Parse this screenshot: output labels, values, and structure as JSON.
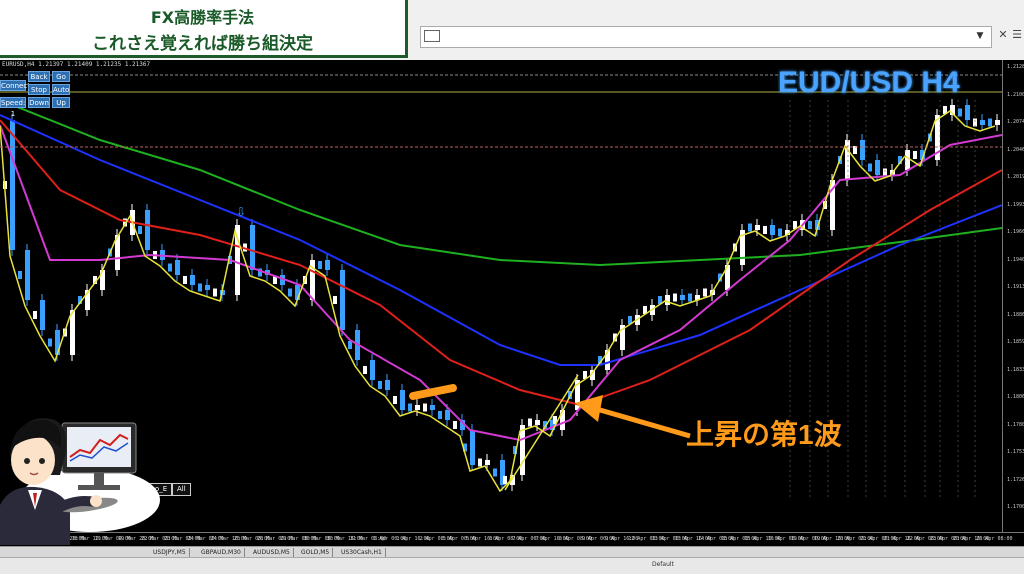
{
  "banner": {
    "line1": "FX高勝率手法",
    "line2": "これさえ覚えれば勝ち組決定"
  },
  "window": {
    "close": "✕",
    "min": "—",
    "drop": "▼"
  },
  "chart_info": "EURUSD,H4  1.21397 1.21409 1.21235 1.21367",
  "controls": {
    "back": "Back",
    "go": "Go",
    "connect": "Connect",
    "stop": "Stop",
    "auto": "Auto",
    "speed": "Speed: 1",
    "down": "Down",
    "up": "Up"
  },
  "pair_label": "EUD/USD H4",
  "annotation": "上昇の第1波",
  "bottom_buttons": {
    "fibo": "Fibo_E",
    "all": "All"
  },
  "price_labels": [
    "1.21285",
    "1.21005",
    "1.20740",
    "1.20460",
    "1.20195",
    "1.19930",
    "1.19665",
    "1.19400",
    "1.19130",
    "1.18860",
    "1.18595",
    "1.18330",
    "1.18065",
    "1.17800",
    "1.17530",
    "1.17265",
    "1.17000"
  ],
  "x_labels": [
    "16 Mar 2021",
    "17 Mar 04:00",
    "17 Mar 20:00",
    "18 Mar 12:00",
    "19 Mar 04:00",
    "19 Mar 20:00",
    "22 Mar 08:00",
    "23 Mar 08:00",
    "24 Mar 00:00",
    "24 Mar 16:00",
    "25 Mar 08:00",
    "26 Mar 00:00",
    "29 Mar 08:00",
    "30 Mar 00:00",
    "30 Mar 16:00",
    "31 Mar 08:00",
    "1 Apr 00:00",
    "1 Apr 16:00",
    "2 Apr 08:00",
    "5 Apr 00:00",
    "5 Apr 16:00",
    "6 Apr 08:00",
    "7 Apr 00:00",
    "7 Apr 16:00",
    "8 Apr 08:00",
    "9 Apr 00:00",
    "9 Apr 16:00",
    "12 Apr 08:00",
    "13 Apr 00:00",
    "13 Apr 16:00",
    "14 Apr 08:00",
    "15 Apr 00:00",
    "15 Apr 16:00",
    "16 Apr 08:00",
    "19 Apr 00:00",
    "19 Apr 16:00",
    "20 Apr 08:00",
    "21 Apr 00:00",
    "21 Apr 16:00",
    "22 Apr 08:00",
    "23 Apr 00:00",
    "23 Apr 16:00",
    "26 Apr 08:00"
  ],
  "tabs": [
    "USDJPY,M5",
    "GBPAUD,M30",
    "AUDUSD,M5",
    "GOLD,M5",
    "US30Cash,H1"
  ],
  "status_default": "Default",
  "colors": {
    "ma_fast": "#e8e23a",
    "ma_pink": "#d23ad2",
    "ma_red": "#e0201a",
    "ma_blue": "#1e32ff",
    "ma_green": "#1fb020",
    "candle_up": "#ffffff",
    "candle_dn": "#3aa0ff",
    "accent": "#ff9a1a",
    "pair": "#4aa3ff"
  }
}
